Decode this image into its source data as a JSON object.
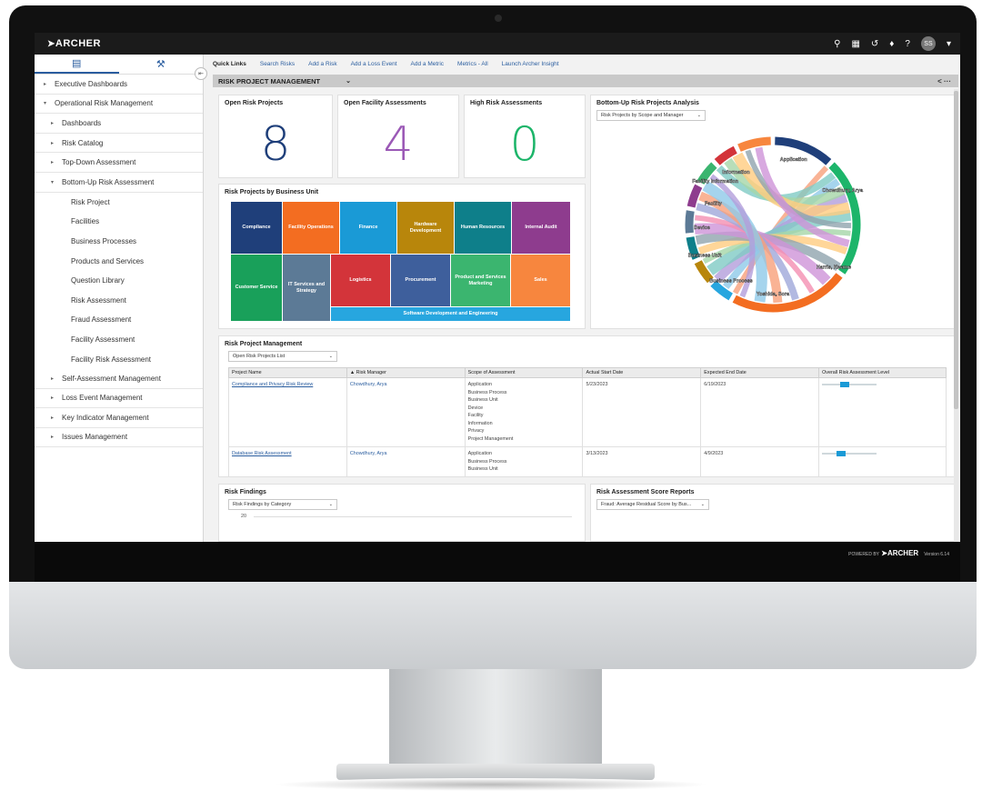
{
  "app": {
    "logo": "ARCHER",
    "version": "Version 6.14",
    "footer_logo": "ARCHER",
    "powered_by": "POWERED BY"
  },
  "topbar": {
    "avatar": "SS"
  },
  "sidebar": {
    "items": [
      {
        "label": "Executive Dashboards",
        "caret": "▸"
      },
      {
        "label": "Operational Risk Management",
        "caret": "▾"
      },
      {
        "label": "Dashboards",
        "caret": "▸"
      },
      {
        "label": "Risk Catalog",
        "caret": "▸"
      },
      {
        "label": "Top-Down Assessment",
        "caret": "▸"
      },
      {
        "label": "Bottom-Up Risk Assessment",
        "caret": "▾"
      },
      {
        "label": "Risk Project"
      },
      {
        "label": "Facilities"
      },
      {
        "label": "Business Processes"
      },
      {
        "label": "Products and Services"
      },
      {
        "label": "Question Library"
      },
      {
        "label": "Risk Assessment"
      },
      {
        "label": "Fraud Assessment"
      },
      {
        "label": "Facility Assessment"
      },
      {
        "label": "Facility Risk Assessment"
      },
      {
        "label": "Self-Assessment Management",
        "caret": "▸"
      },
      {
        "label": "Loss Event Management",
        "caret": "▸"
      },
      {
        "label": "Key Indicator Management",
        "caret": "▸"
      },
      {
        "label": "Issues Management",
        "caret": "▸"
      }
    ]
  },
  "quick_links": {
    "title": "Quick Links",
    "links": [
      "Search Risks",
      "Add a Risk",
      "Add a Loss Event",
      "Add a Metric",
      "Metrics - All",
      "Launch Archer Insight"
    ]
  },
  "page": {
    "title": "RISK PROJECT MANAGEMENT"
  },
  "kpis": [
    {
      "title": "Open Risk Projects",
      "value": "8",
      "color": "#1f3f7a"
    },
    {
      "title": "Open Facility Assessments",
      "value": "4",
      "color": "#9b59b6"
    },
    {
      "title": "High Risk Assessments",
      "value": "0",
      "color": "#1db56a"
    }
  ],
  "treemap": {
    "title": "Risk Projects by Business Unit",
    "tiles": [
      {
        "label": "Compliance",
        "color": "#1f3f7a"
      },
      {
        "label": "Facility Operations",
        "color": "#f36d21"
      },
      {
        "label": "Finance",
        "color": "#1a9ad6"
      },
      {
        "label": "Hardware Development",
        "color": "#b8860b"
      },
      {
        "label": "Human Resources",
        "color": "#0e7f8a"
      },
      {
        "label": "Internal Audit",
        "color": "#8e3c8e"
      },
      {
        "label": "Customer Service",
        "color": "#19a05a"
      },
      {
        "label": "IT Services and Strategy",
        "color": "#5c7a96"
      },
      {
        "label": "Logistics",
        "color": "#d3343a"
      },
      {
        "label": "Procurement",
        "color": "#3e5f9c"
      },
      {
        "label": "Product and Services Marketing",
        "color": "#3bb56f"
      },
      {
        "label": "Sales",
        "color": "#f7863e"
      },
      {
        "label": "Software Development and Engineering",
        "color": "#27a6df"
      }
    ]
  },
  "chord": {
    "title": "Bottom-Up Risk Projects Analysis",
    "dropdown": "Risk Projects by Scope and Manager",
    "labels": [
      "Application",
      "Information",
      "Facility Information",
      "Facility",
      "Device",
      "Business Unit",
      "Business Process",
      "Yoshida, Sora",
      "Harris, Kwame",
      "Chowdhury, Arya"
    ]
  },
  "table": {
    "title": "Risk Project Management",
    "dropdown": "Open Risk Projects List",
    "columns": [
      "Project Name",
      "Risk Manager",
      "Scope of Assessment",
      "Actual Start Date",
      "Expected End Date",
      "Overall Risk Assessment Level"
    ],
    "rows": [
      {
        "name": "Compliance and Privacy Risk Review",
        "manager": "Chowdhury, Arya",
        "scope": [
          "Application",
          "Business Process",
          "Business Unit",
          "Device",
          "Facility",
          "Information",
          "Privacy",
          "Project Management"
        ],
        "start": "5/23/2023",
        "end": "6/19/2023",
        "level": 0.5
      },
      {
        "name": "Database Risk Assessment",
        "manager": "Chowdhury, Arya",
        "scope": [
          "Application",
          "Business Process",
          "Business Unit"
        ],
        "start": "3/13/2023",
        "end": "4/9/2023",
        "level": 0.4
      }
    ]
  },
  "findings": {
    "title": "Risk Findings",
    "dropdown": "Risk Findings by Category",
    "axis_tick": "20"
  },
  "reports": {
    "title": "Risk Assessment Score Reports",
    "dropdown": "Fraud: Average Residual Score by Bus..."
  }
}
